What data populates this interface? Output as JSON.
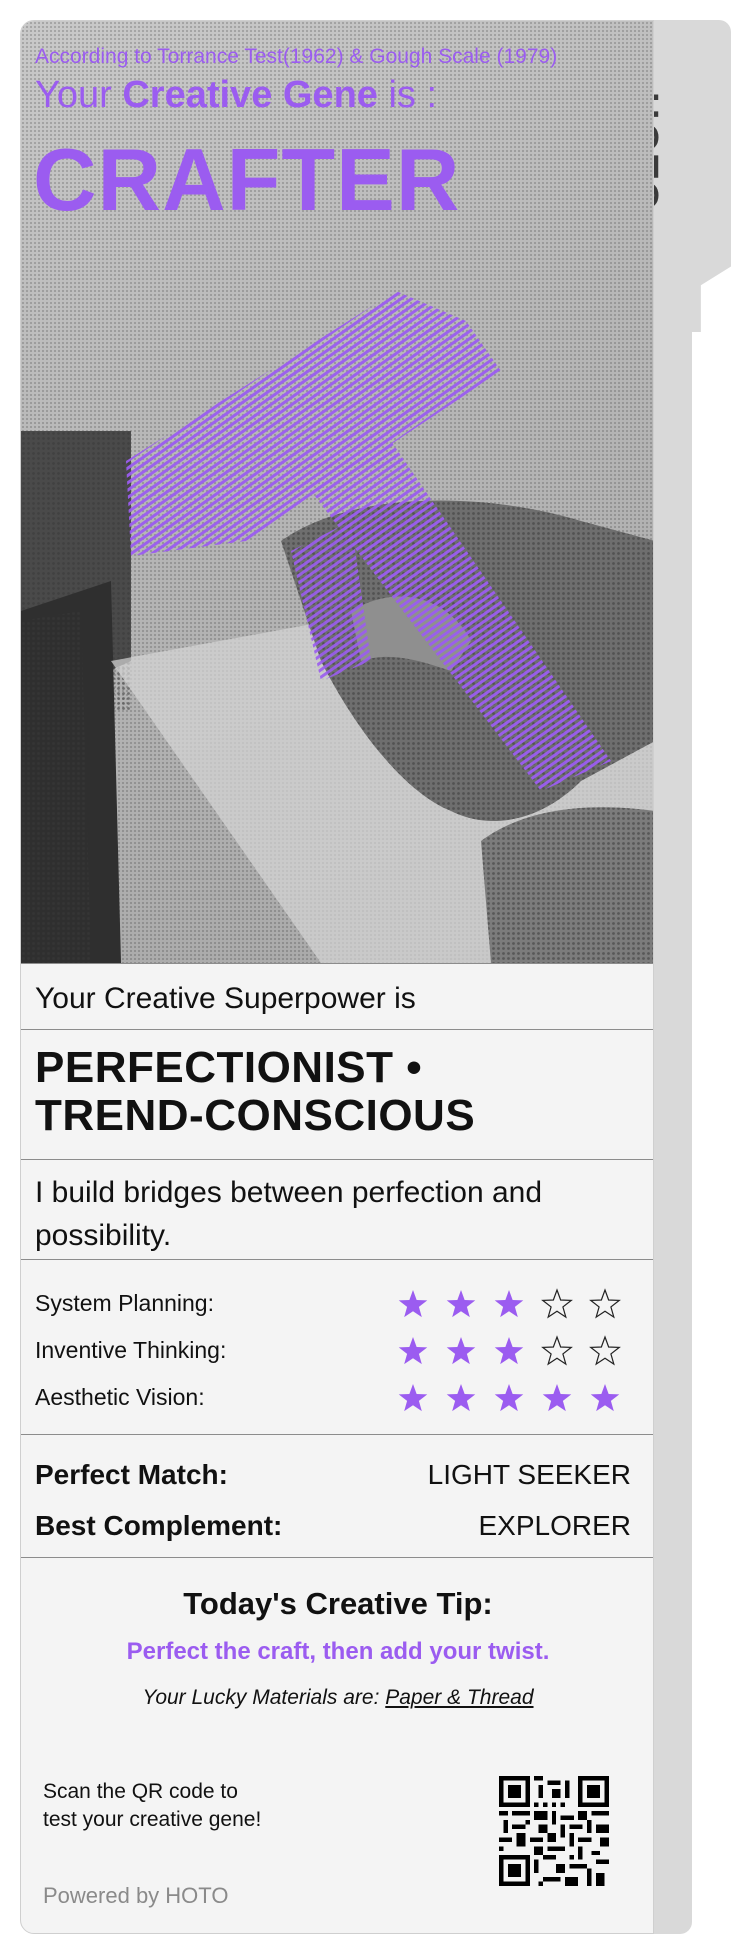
{
  "side_tab": {
    "brand": "HOTO"
  },
  "hero": {
    "subtitle": "According to Torrance Test(1962) & Gough Scale (1979)",
    "gene_prefix": "Your",
    "gene_emphasis": "Creative Gene",
    "gene_suffix": " is :",
    "gene_type": "CRAFTER"
  },
  "superpower": {
    "label": "Your Creative Superpower is",
    "title_line1": "PERFECTIONIST •",
    "title_line2": "TREND-CONSCIOUS",
    "description": "I build bridges between perfection and possibility."
  },
  "ratings": [
    {
      "label": "System Planning:",
      "value": 3,
      "max": 5
    },
    {
      "label": "Inventive Thinking:",
      "value": 3,
      "max": 5
    },
    {
      "label": "Aesthetic Vision:",
      "value": 5,
      "max": 5
    }
  ],
  "matches": {
    "perfect_label": "Perfect Match:",
    "perfect_value": "LIGHT SEEKER",
    "complement_label": "Best Complement:",
    "complement_value": "EXPLORER"
  },
  "tip": {
    "title": "Today's Creative Tip:",
    "text": "Perfect the craft, then add your twist.",
    "lucky_prefix": "Your Lucky Materials are: ",
    "lucky_materials": "Paper & Thread"
  },
  "footer": {
    "scan_line1": "Scan the QR code to",
    "scan_line2": "test your creative gene!",
    "powered": "Powered by HOTO"
  },
  "colors": {
    "accent": "#9b5cf0",
    "strip": "#d9d9d9",
    "card": "#f4f4f4"
  },
  "icons": {
    "rating_filled": "star-filled-icon",
    "rating_empty": "star-outline-icon"
  }
}
